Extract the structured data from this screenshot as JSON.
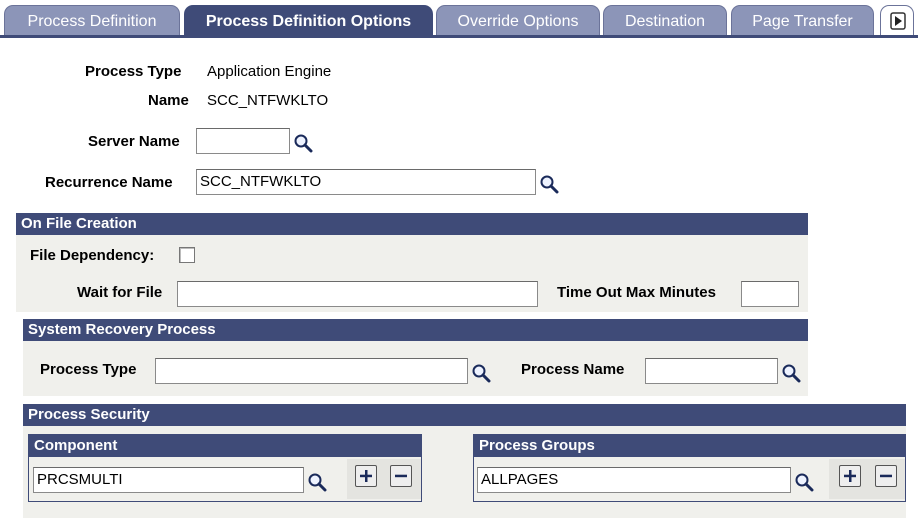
{
  "tabs": [
    {
      "label": "Process Definition",
      "active": false
    },
    {
      "label": "Process Definition Options",
      "active": true
    },
    {
      "label": "Override Options",
      "active": false
    },
    {
      "label": "Destination",
      "active": false
    },
    {
      "label": "Page Transfer",
      "active": false
    }
  ],
  "header_info": {
    "process_type_label": "Process Type",
    "process_type_value": "Application Engine",
    "name_label": "Name",
    "name_value": "SCC_NTFWKLTO"
  },
  "server": {
    "label": "Server Name",
    "value": ""
  },
  "recurrence": {
    "label": "Recurrence Name",
    "value": "SCC_NTFWKLTO"
  },
  "file_creation": {
    "title": "On File Creation",
    "dependency_label": "File Dependency:",
    "dependency_checked": false,
    "wait_label": "Wait for File",
    "wait_value": "",
    "timeout_label": "Time Out Max Minutes",
    "timeout_value": ""
  },
  "recovery": {
    "title": "System Recovery Process",
    "type_label": "Process Type",
    "type_value": "",
    "name_label": "Process Name",
    "name_value": ""
  },
  "security": {
    "title": "Process Security",
    "component": {
      "header": "Component",
      "value": "PRCSMULTI"
    },
    "groups": {
      "header": "Process Groups",
      "value": "ALLPAGES"
    }
  },
  "colors": {
    "header_bg": "#3f4b78",
    "tab_inactive": "#8c95b8",
    "panel_bg": "#f0f0ec"
  }
}
